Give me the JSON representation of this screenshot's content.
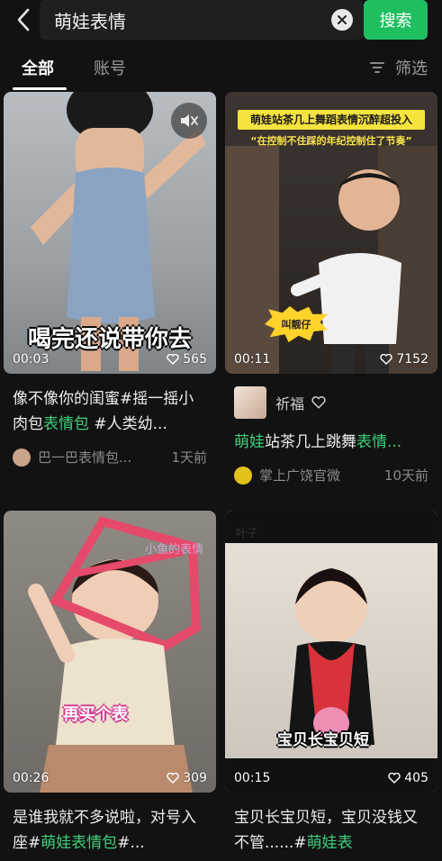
{
  "search": {
    "query": "萌娃表情",
    "button_label": "搜索"
  },
  "tabs": {
    "all": "全部",
    "account": "账号",
    "filter": "筛选"
  },
  "colors": {
    "accent": "#1fbf60",
    "highlight": "#3fd07a",
    "background": "#121212"
  },
  "cards": [
    {
      "caption": "喝完还说带你去",
      "duration": "00:03",
      "likes": "565",
      "title_parts": [
        "像不像你的闺蜜#摇一摇小肉包",
        "表情包",
        " #人类幼..."
      ],
      "author": "巴一巴表情包...",
      "time": "1天前"
    },
    {
      "banner": "萌娃站茶几上舞蹈表情沉醉超投入",
      "banner_sub": "“在控制不住踩的年纪控制住了节奏”",
      "burst": "叫靓仔",
      "duration": "00:11",
      "likes": "7152",
      "author_name": "祈福",
      "title_parts": [
        "萌娃",
        "站茶几上跳舞",
        "表情..."
      ],
      "author": "掌上广饶官微",
      "time": "10天前"
    },
    {
      "caption": "再买个表",
      "watermark": "小鱼的表情",
      "duration": "00:26",
      "likes": "309",
      "title_parts": [
        "是谁我就不多说啦，对号入座#",
        "萌娃表情包",
        "#..."
      ]
    },
    {
      "tag": "叶子",
      "caption": "宝贝长宝贝短",
      "duration": "00:15",
      "likes": "405",
      "title_parts": [
        "宝贝长宝贝短，宝贝没钱又不管......#",
        "萌娃表",
        ""
      ]
    }
  ]
}
